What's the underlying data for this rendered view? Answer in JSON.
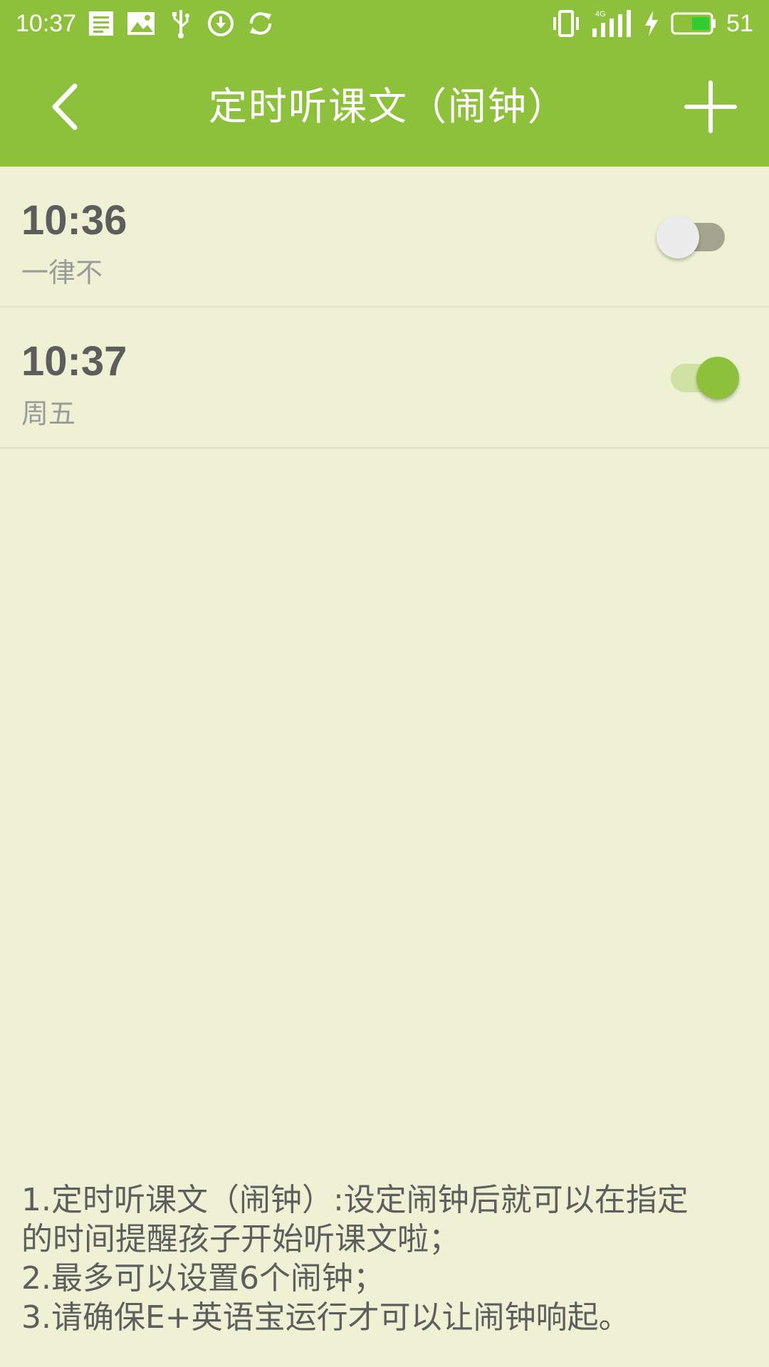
{
  "status_bar": {
    "time": "10:37",
    "battery_level": "51",
    "network_label": "4G",
    "icons": [
      "notes-icon",
      "image-icon",
      "usb-icon",
      "download-icon",
      "sync-icon",
      "vibrate-icon",
      "signal-4g-icon",
      "charging-icon",
      "battery-icon"
    ]
  },
  "app_bar": {
    "title": "定时听课文（闹钟）",
    "back_icon": "chevron-left-icon",
    "add_icon": "plus-icon"
  },
  "alarms": [
    {
      "time": "10:36",
      "repeat": "一律不",
      "enabled": false
    },
    {
      "time": "10:37",
      "repeat": "周五",
      "enabled": true
    }
  ],
  "notes": [
    "1.定时听课文（闹钟）:设定闹钟后就可以在指定",
    "的时间提醒孩子开始听课文啦；",
    "2.最多可以设置6个闹钟；",
    "3.请确保E+英语宝运行才可以让闹钟响起。"
  ],
  "colors": {
    "accent": "#8dc13c",
    "background": "#eff1d4",
    "text_primary": "#5d5d5d",
    "text_secondary": "#9a9a9a"
  }
}
